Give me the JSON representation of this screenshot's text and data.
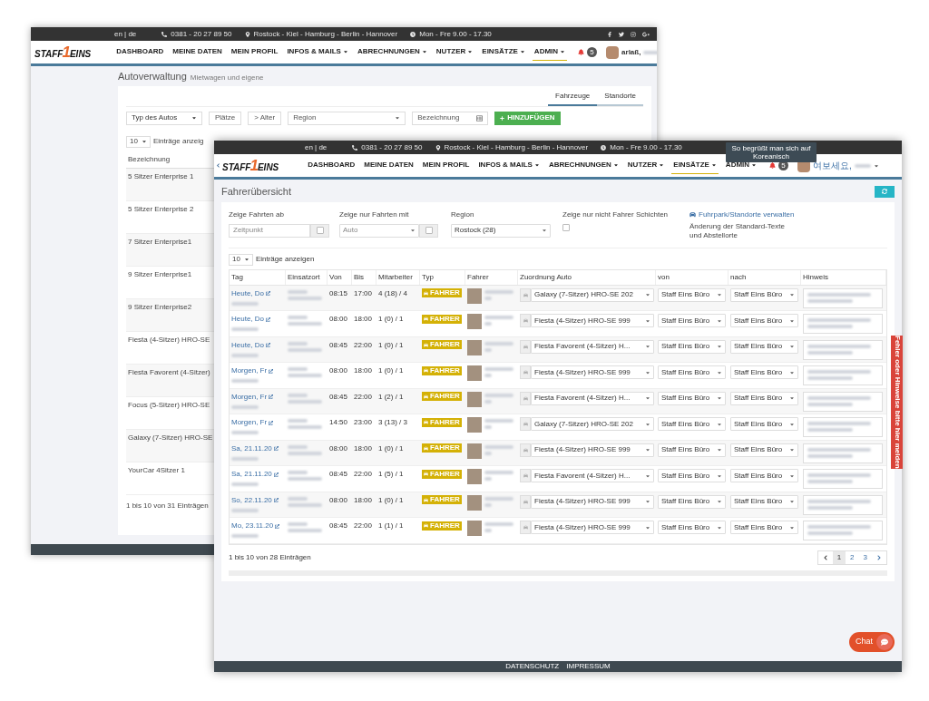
{
  "back_window": {
    "top_bar": {
      "language": "en | de",
      "phone": "0381 - 20 27 89 50",
      "location": "Rostock - Kiel - Hamburg - Berlin - Hannover",
      "hours": "Mon - Fre 9.00 - 17.30"
    },
    "nav": {
      "logo": {
        "left": "STAFF",
        "mark": "1",
        "right": "EINS"
      },
      "items": [
        {
          "label": "DASHBOARD",
          "dropdown": false,
          "selected": false
        },
        {
          "label": "MEINE DATEN",
          "dropdown": false,
          "selected": false
        },
        {
          "label": "MEIN PROFIL",
          "dropdown": false,
          "selected": false
        },
        {
          "label": "INFOS & MAILS",
          "dropdown": true,
          "selected": false
        },
        {
          "label": "ABRECHNUNGEN",
          "dropdown": true,
          "selected": false
        },
        {
          "label": "NUTZER",
          "dropdown": true,
          "selected": false
        },
        {
          "label": "EINSÄTZE",
          "dropdown": true,
          "selected": false
        },
        {
          "label": "ADMIN",
          "dropdown": true,
          "selected": true
        }
      ],
      "notification_count": "5",
      "user_name": "arlaß,"
    },
    "title": "Autoverwaltung",
    "subtitle": "Mietwagen und eigene",
    "tabs": [
      {
        "label": "Fahrzeuge",
        "selected": true
      },
      {
        "label": "Standorte",
        "selected": false
      }
    ],
    "filters": {
      "car_type": "Typ des Autos",
      "seats": "Plätze",
      "age": "> Alter",
      "region": "Region",
      "name_placeholder": "Bezeichnung",
      "add_button": "HINZUFÜGEN"
    },
    "entries_select": "10",
    "entries_label": "Einträge anzeig",
    "table": {
      "column": "Bezeichnung",
      "rows": [
        "5 Sitzer Enterprise 1",
        "5 Sitzer Enterprise 2",
        "7 Sitzer Enterprise1",
        "9 Sitzer Enterprise1",
        "9 Sitzer Enterprise2",
        "Fiesta (4-Sitzer) HRO-SE",
        "Fiesta Favorent (4-Sitzer)",
        "Focus (5-Sitzer) HRO-SE",
        "Galaxy (7-Sitzer) HRO-SE",
        "YourCar 4Sitzer 1"
      ]
    },
    "footer": "1 bis 10 von 31 Einträgen"
  },
  "front_window": {
    "top_bar": {
      "language": "en | de",
      "phone": "0381 - 20 27 89 50",
      "location": "Rostock - Kiel - Hamburg - Berlin - Hannover",
      "hours": "Mon - Fre 9.00 - 17.30"
    },
    "tooltip": "So begrüßt man sich auf Koreanisch",
    "nav": {
      "logo": {
        "left": "STAFF",
        "mark": "1",
        "right": "EINS"
      },
      "items": [
        {
          "label": "DASHBOARD",
          "dropdown": false,
          "selected": false
        },
        {
          "label": "MEINE DATEN",
          "dropdown": false,
          "selected": false
        },
        {
          "label": "MEIN PROFIL",
          "dropdown": false,
          "selected": false
        },
        {
          "label": "INFOS & MAILS",
          "dropdown": true,
          "selected": false
        },
        {
          "label": "ABRECHNUNGEN",
          "dropdown": true,
          "selected": false
        },
        {
          "label": "NUTZER",
          "dropdown": true,
          "selected": false
        },
        {
          "label": "EINSÄTZE",
          "dropdown": true,
          "selected": true
        },
        {
          "label": "ADMIN",
          "dropdown": true,
          "selected": false
        }
      ],
      "notification_count": "5",
      "user_name": "여보세요,"
    },
    "title": "Fahrerübersicht",
    "filters": {
      "from": {
        "label": "Zeige Fahrten ab",
        "placeholder": "Zeitpunkt",
        "checked": false
      },
      "with": {
        "label": "Zeige nur Fahrten mit",
        "value": "Auto",
        "checked": false
      },
      "region": {
        "label": "Region",
        "value": "Rostock (28)"
      },
      "non_driver": {
        "label": "Zeige nur nicht Fahrer Schichten",
        "checked": false
      },
      "manage_link": "Fuhrpark/Standorte verwalten",
      "manage_note": "Änderung der Standard-Texte und Abstellorte"
    },
    "entries_select": "10",
    "entries_label": "Einträge anzeigen",
    "table": {
      "columns": [
        "Tag",
        "Einsatzort",
        "Von",
        "Bis",
        "Mitarbeiter",
        "Typ",
        "Fahrer",
        "Zuordnung Auto",
        "von",
        "nach",
        "Hinweis"
      ],
      "rows": [
        {
          "tag": "Heute, Do",
          "von": "08:15",
          "bis": "17:00",
          "mitarbeiter": "4 (18) / 4",
          "typ": "FAHRER",
          "auto": "Galaxy (7-Sitzer) HRO-SE 202",
          "from": "Staff Eins Büro",
          "to": "Staff Eins Büro"
        },
        {
          "tag": "Heute, Do",
          "von": "08:00",
          "bis": "18:00",
          "mitarbeiter": "1 (0) / 1",
          "typ": "FAHRER",
          "auto": "Fiesta (4-Sitzer) HRO-SE 999",
          "from": "Staff Eins Büro",
          "to": "Staff Eins Büro"
        },
        {
          "tag": "Heute, Do",
          "von": "08:45",
          "bis": "22:00",
          "mitarbeiter": "1 (0) / 1",
          "typ": "FAHRER",
          "auto": "Fiesta Favorent (4-Sitzer) H...",
          "from": "Staff Eins Büro",
          "to": "Staff Eins Büro"
        },
        {
          "tag": "Morgen, Fr",
          "von": "08:00",
          "bis": "18:00",
          "mitarbeiter": "1 (0) / 1",
          "typ": "FAHRER",
          "auto": "Fiesta (4-Sitzer) HRO-SE 999",
          "from": "Staff Eins Büro",
          "to": "Staff Eins Büro"
        },
        {
          "tag": "Morgen, Fr",
          "von": "08:45",
          "bis": "22:00",
          "mitarbeiter": "1 (2) / 1",
          "typ": "FAHRER",
          "auto": "Fiesta Favorent (4-Sitzer) H...",
          "from": "Staff Eins Büro",
          "to": "Staff Eins Büro"
        },
        {
          "tag": "Morgen, Fr",
          "von": "14:50",
          "bis": "23:00",
          "mitarbeiter": "3 (13) / 3",
          "typ": "FAHRER",
          "auto": "Galaxy (7-Sitzer) HRO-SE 202",
          "from": "Staff Eins Büro",
          "to": "Staff Eins Büro"
        },
        {
          "tag": "Sa, 21.11.20",
          "von": "08:00",
          "bis": "18:00",
          "mitarbeiter": "1 (0) / 1",
          "typ": "FAHRER",
          "auto": "Fiesta (4-Sitzer) HRO-SE 999",
          "from": "Staff Eins Büro",
          "to": "Staff Eins Büro"
        },
        {
          "tag": "Sa, 21.11.20",
          "von": "08:45",
          "bis": "22:00",
          "mitarbeiter": "1 (5) / 1",
          "typ": "FAHRER",
          "auto": "Fiesta Favorent (4-Sitzer) H...",
          "from": "Staff Eins Büro",
          "to": "Staff Eins Büro"
        },
        {
          "tag": "So, 22.11.20",
          "von": "08:00",
          "bis": "18:00",
          "mitarbeiter": "1 (0) / 1",
          "typ": "FAHRER",
          "auto": "Fiesta (4-Sitzer) HRO-SE 999",
          "from": "Staff Eins Büro",
          "to": "Staff Eins Büro"
        },
        {
          "tag": "Mo, 23.11.20",
          "von": "08:45",
          "bis": "22:00",
          "mitarbeiter": "1 (1) / 1",
          "typ": "FAHRER",
          "auto": "Fiesta (4-Sitzer) HRO-SE 999",
          "from": "Staff Eins Büro",
          "to": "Staff Eins Büro"
        }
      ]
    },
    "footer": "1 bis 10 von 28 Einträgen",
    "pagination": [
      {
        "label": "1",
        "selected": true
      },
      {
        "label": "2",
        "selected": false
      },
      {
        "label": "3",
        "selected": false
      }
    ],
    "bottom_links": [
      "DATENSCHUTZ",
      "IMPRESSUM"
    ],
    "chat": "Chat"
  },
  "feedback_tab": "Fehler oder Hinweise bitte hier melden"
}
